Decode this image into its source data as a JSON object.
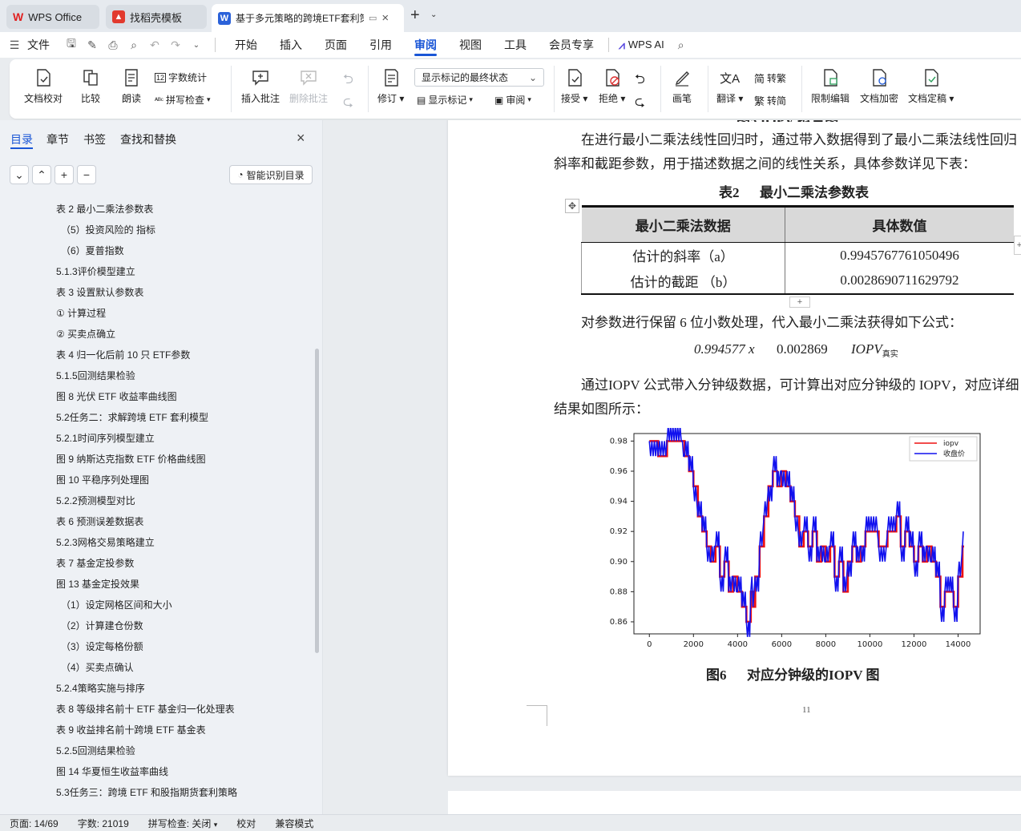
{
  "tabs": [
    {
      "label": "WPS Office",
      "logo": "W"
    },
    {
      "label": "找稻壳模板",
      "logo": "稻"
    },
    {
      "label": "基于多元策略的跨境ETF套利策",
      "logo": "W"
    }
  ],
  "menus": [
    "文件",
    "开始",
    "插入",
    "页面",
    "引用",
    "审阅",
    "视图",
    "工具",
    "会员专享",
    "WPS AI"
  ],
  "ribbon": {
    "doc_check": "文档校对",
    "compare": "比较",
    "read_aloud": "朗读",
    "word_count": "字数统计",
    "spell_check": "拼写检查",
    "insert_comment": "插入批注",
    "delete_comment": "删除批注",
    "revise": "修订",
    "markup_state": "显示标记的最终状态",
    "show_markup": "显示标记",
    "review": "审阅",
    "accept": "接受",
    "reject": "拒绝",
    "pen": "画笔",
    "translate": "翻译",
    "to_traditional": "转繁",
    "to_simplified": "转简",
    "restrict_edit": "限制编辑",
    "encrypt": "文档加密",
    "finalize": "文档定稿"
  },
  "nav": {
    "tabs": [
      "目录",
      "章节",
      "书签",
      "查找和替换"
    ],
    "smart_toc": "智能识别目录",
    "items": [
      "表 2  最小二乘法参数表",
      "（5）投资风险的    指标",
      "（6）夏普指数",
      "5.1.3评价模型建立",
      "表 3  设置默认参数表",
      "① 计算过程",
      "② 买卖点确立",
      "表 4  归一化后前 10 只 ETF参数",
      "5.1.5回测结果检验",
      "图 8  光伏 ETF 收益率曲线图",
      "5.2任务二：求解跨境 ETF 套利模型",
      "5.2.1时间序列模型建立",
      "图 9  纳斯达克指数 ETF 价格曲线图",
      "图 10  平稳序列处理图",
      "5.2.2预测模型对比",
      "表 6  预测误差数据表",
      "5.2.3网格交易策略建立",
      "表 7  基金定投参数",
      "图 13  基金定投效果",
      "（1）设定网格区间和大小",
      "（2）计算建仓份数",
      "（3）设定每格份额",
      "（4）买卖点确认",
      "5.2.4策略实施与排序",
      "表 8  等级排名前十 ETF 基金归一化处理表",
      "表 9  收益排名前十跨境 ETF 基金表",
      "5.2.5回测结果检验",
      "图 14  华夏恒生收益率曲线",
      "5.3任务三：跨境 ETF 和股指期货套利策略"
    ]
  },
  "document": {
    "para1_line1": "在进行最小二乘法线性回归时，通过带入数据得到了最小二乘法线性回归",
    "para1_line2": "斜率和截距参数，用于描述数据之间的线性关系，具体参数详见下表：",
    "table_caption": "表2      最小二乘法参数表",
    "table_headers": [
      "最小二乘法数据",
      "具体数值"
    ],
    "table_rows": [
      [
        "估计的斜率（a）",
        "0.9945767761050496"
      ],
      [
        "估计的截距 （b）",
        "0.0028690711629792"
      ]
    ],
    "para2": "对参数进行保留 6 位小数处理，代入最小二乘法获得如下公式：",
    "formula_a": "0.994577 x",
    "formula_b": "0.002869",
    "formula_c": "IOPV",
    "formula_sub": "真实",
    "para3_line1": "通过IOPV 公式带入分钟级数据，可计算出对应分钟级的 IOPV，对应详细",
    "para3_line2": "结果如图所示：",
    "figure_caption": "图6      对应分钟级的IOPV 图",
    "page_number": "11"
  },
  "chart_data": {
    "type": "line",
    "x_ticks": [
      "0",
      "2000",
      "4000",
      "6000",
      "8000",
      "10000",
      "12000",
      "14000"
    ],
    "y_ticks": [
      "0.98",
      "0.96",
      "0.94",
      "0.92",
      "0.90",
      "0.88",
      "0.86"
    ],
    "xlim": [
      -700,
      15000
    ],
    "ylim": [
      0.852,
      0.985
    ],
    "legend_position": "top-right",
    "series": [
      {
        "name": "iopv",
        "color": "#ee1111"
      },
      {
        "name": "收盘价",
        "color": "#1111ee"
      }
    ],
    "points_x": [
      0,
      400,
      800,
      1500,
      1600,
      1800,
      2000,
      2200,
      2400,
      2600,
      2800,
      3000,
      3200,
      3400,
      3600,
      3800,
      4000,
      4200,
      4400,
      4600,
      4700,
      4800,
      5000,
      5200,
      5400,
      5600,
      5800,
      6000,
      6200,
      6400,
      6600,
      6800,
      7000,
      7200,
      7400,
      7600,
      7800,
      8000,
      8200,
      8400,
      8600,
      8800,
      9000,
      9200,
      9400,
      9600,
      9800,
      10000,
      10400,
      10800,
      11200,
      11400,
      11600,
      11800,
      12000,
      12200,
      12400,
      12600,
      12800,
      13000,
      13200,
      13400,
      13600,
      13800,
      14000,
      14200
    ],
    "points_y": [
      0.98,
      0.97,
      0.98,
      0.98,
      0.97,
      0.96,
      0.95,
      0.93,
      0.92,
      0.91,
      0.9,
      0.91,
      0.89,
      0.9,
      0.88,
      0.89,
      0.88,
      0.87,
      0.86,
      0.88,
      0.87,
      0.89,
      0.91,
      0.93,
      0.95,
      0.96,
      0.95,
      0.96,
      0.95,
      0.94,
      0.93,
      0.91,
      0.92,
      0.91,
      0.92,
      0.9,
      0.91,
      0.9,
      0.91,
      0.89,
      0.9,
      0.88,
      0.9,
      0.91,
      0.9,
      0.91,
      0.92,
      0.92,
      0.91,
      0.92,
      0.93,
      0.91,
      0.92,
      0.91,
      0.9,
      0.91,
      0.9,
      0.91,
      0.9,
      0.89,
      0.87,
      0.88,
      0.88,
      0.87,
      0.89,
      0.91
    ]
  },
  "status": {
    "page": "页面: 14/69",
    "words": "字数: 21019",
    "spell": "拼写检查: 关闭",
    "proof": "校对",
    "compat": "兼容模式"
  }
}
